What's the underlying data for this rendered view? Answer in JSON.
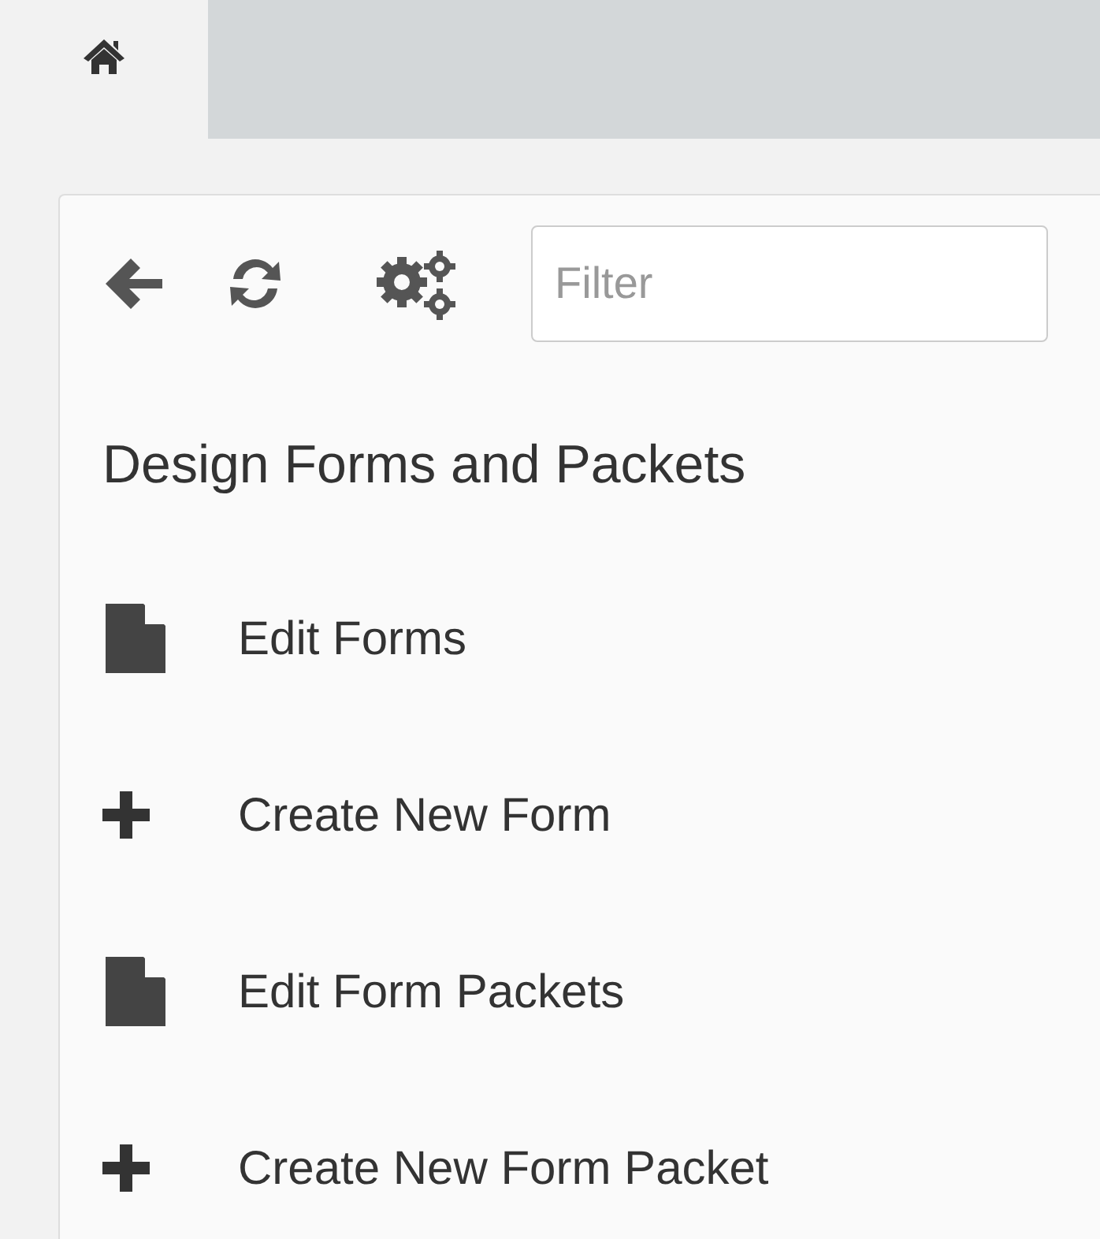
{
  "tabs": [
    {
      "kind": "home",
      "selected": true
    }
  ],
  "toolbar": {
    "filter": {
      "placeholder": "Filter"
    }
  },
  "panel": {
    "title": "Design Forms and Packets",
    "items": [
      {
        "kind": "document",
        "label": "Edit Forms"
      },
      {
        "kind": "plus",
        "label": "Create New Form"
      },
      {
        "kind": "document",
        "label": "Edit Form Packets"
      },
      {
        "kind": "plus",
        "label": "Create New Form Packet"
      }
    ]
  }
}
